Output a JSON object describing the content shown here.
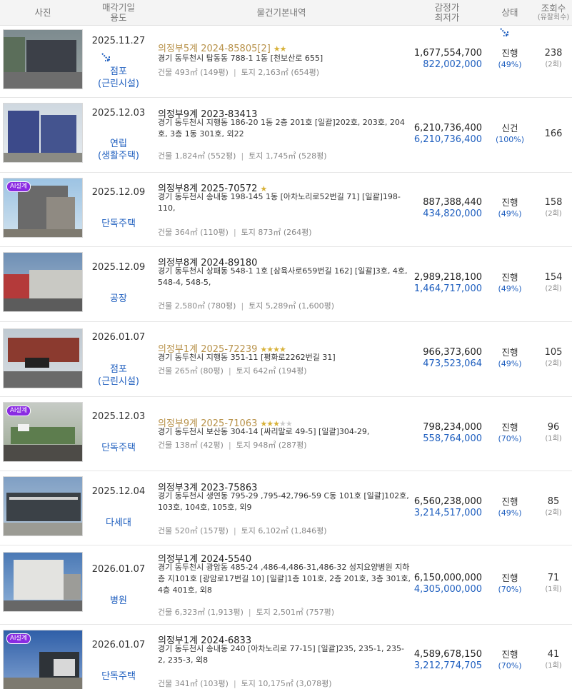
{
  "header": {
    "photo": "사진",
    "date_line1": "매각기일",
    "date_line2": "용도",
    "basic": "물건기본내역",
    "price_line1": "감정가",
    "price_line2": "최저가",
    "status": "상태",
    "views_line1": "조회수",
    "views_line2": "(유찰회수)"
  },
  "rows": [
    {
      "date": "2025.11.27",
      "usage1": "점포",
      "usage2": "(근린시설)",
      "title": "의정부5계 2024-85805[2]",
      "stars": "★★",
      "stars_off": "",
      "addr": "경기 동두천시 탑동동 788-1 1동 [천보산로 655]",
      "bldg_label": "건물 493㎡ (149평)",
      "land_label": "토지 2,163㎡ (654평)",
      "appraisal": "1,677,554,700",
      "minimum": "822,002,000",
      "status": "진행",
      "pct": "(49%)",
      "views": "238",
      "fails": "(2회)"
    },
    {
      "date": "2025.12.03",
      "usage1": "연립",
      "usage2": "(생활주택)",
      "title": "의정부9계 2023-83413",
      "stars": "",
      "stars_off": "",
      "addr": "경기 동두천시 지행동 186-20 1동 2층 201호 [일괄]202호, 203호, 204호, 3층 1동 301호, 외22",
      "bldg_label": "건물 1,824㎡ (552평)",
      "land_label": "토지 1,745㎡ (528평)",
      "appraisal": "6,210,736,400",
      "minimum": "6,210,736,400",
      "status": "신건",
      "pct": "(100%)",
      "views": "166",
      "fails": ""
    },
    {
      "date": "2025.12.09",
      "usage1": "단독주택",
      "usage2": "",
      "title": "의정부8계 2025-70572",
      "stars": "★",
      "stars_off": "",
      "addr": "경기 동두천시 송내동 198-145 1동 [아차노리로52번길 71] [일괄]198-110,",
      "bldg_label": "건물 364㎡ (110평)",
      "land_label": "토지 873㎡ (264평)",
      "appraisal": "887,388,440",
      "minimum": "434,820,000",
      "status": "진행",
      "pct": "(49%)",
      "views": "158",
      "fails": "(2회)",
      "ai": "AI설계"
    },
    {
      "date": "2025.12.09",
      "usage1": "공장",
      "usage2": "",
      "title": "의정부8계 2024-89180",
      "stars": "",
      "stars_off": "",
      "addr": "경기 동두천시 상패동 548-1 1호 [삼육사로659번길 162] [일괄]3호, 4호, 548-4, 548-5,",
      "bldg_label": "건물 2,580㎡ (780평)",
      "land_label": "토지 5,289㎡ (1,600평)",
      "appraisal": "2,989,218,100",
      "minimum": "1,464,717,000",
      "status": "진행",
      "pct": "(49%)",
      "views": "154",
      "fails": "(2회)"
    },
    {
      "date": "2026.01.07",
      "usage1": "점포",
      "usage2": "(근린시설)",
      "title": "의정부1계 2025-72239",
      "stars": "★★★★",
      "stars_off": "",
      "addr": "경기 동두천시 지행동 351-11 [평화로2262번길 31]",
      "bldg_label": "건물 265㎡ (80평)",
      "land_label": "토지 642㎡ (194평)",
      "appraisal": "966,373,600",
      "minimum": "473,523,064",
      "status": "진행",
      "pct": "(49%)",
      "views": "105",
      "fails": "(2회)"
    },
    {
      "date": "2025.12.03",
      "usage1": "단독주택",
      "usage2": "",
      "title": "의정부9계 2025-71063",
      "stars": "★★★",
      "stars_off": "★★",
      "addr": "경기 동두천시 보산동 304-14 [싸리말로 49-5] [일괄]304-29,",
      "bldg_label": "건물 138㎡ (42평)",
      "land_label": "토지 948㎡ (287평)",
      "appraisal": "798,234,000",
      "minimum": "558,764,000",
      "status": "진행",
      "pct": "(70%)",
      "views": "96",
      "fails": "(1회)",
      "ai": "AI설계"
    },
    {
      "date": "2025.12.04",
      "usage1": "다세대",
      "usage2": "",
      "title": "의정부3계 2023-75863",
      "stars": "",
      "stars_off": "",
      "addr": "경기 동두천시 생연동 795-29 ,795-42,796-59 C동 101호 [일괄]102호, 103호, 104호, 105호, 외9",
      "bldg_label": "건물 520㎡ (157평)",
      "land_label": "토지 6,102㎡ (1,846평)",
      "appraisal": "6,560,238,000",
      "minimum": "3,214,517,000",
      "status": "진행",
      "pct": "(49%)",
      "views": "85",
      "fails": "(2회)"
    },
    {
      "date": "2026.01.07",
      "usage1": "병원",
      "usage2": "",
      "title": "의정부1계 2024-5540",
      "stars": "",
      "stars_off": "",
      "addr": "경기 동두천시 광암동 485-24 ,486-4,486-31,486-32 성지요양병원 지하층 지101호 [광암로17번길 10] [일괄]1층 101호, 2층 201호, 3층 301호, 4층 401호, 외8",
      "bldg_label": "건물 6,323㎡ (1,913평)",
      "land_label": "토지 2,501㎡ (757평)",
      "appraisal": "6,150,000,000",
      "minimum": "4,305,000,000",
      "status": "진행",
      "pct": "(70%)",
      "views": "71",
      "fails": "(1회)"
    },
    {
      "date": "2026.01.07",
      "usage1": "단독주택",
      "usage2": "",
      "title": "의정부1계 2024-6833",
      "stars": "",
      "stars_off": "",
      "addr": "경기 동두천시 송내동 240 [아차노리로 77-15] [일괄]235, 235-1, 235-2, 235-3, 외8",
      "bldg_label": "건물 341㎡ (103평)",
      "land_label": "토지 10,175㎡ (3,078평)",
      "appraisal": "4,589,678,150",
      "minimum": "3,212,774,705",
      "status": "진행",
      "pct": "(70%)",
      "views": "41",
      "fails": "(1회)",
      "ai": "AI설계"
    }
  ],
  "colors": {
    "accent_blue": "#1f5fbf",
    "gold_title": "#b8924a",
    "star": "#d8b23a",
    "ai_badge": "#8a2be2"
  }
}
